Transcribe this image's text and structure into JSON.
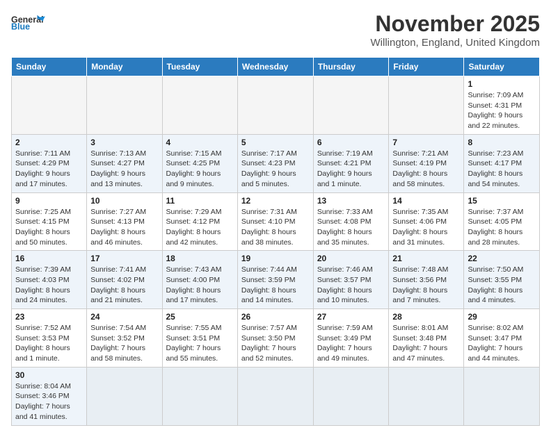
{
  "header": {
    "logo_general": "General",
    "logo_blue": "Blue",
    "month_title": "November 2025",
    "location": "Willington, England, United Kingdom"
  },
  "weekdays": [
    "Sunday",
    "Monday",
    "Tuesday",
    "Wednesday",
    "Thursday",
    "Friday",
    "Saturday"
  ],
  "weeks": [
    [
      {
        "day": "",
        "info": ""
      },
      {
        "day": "",
        "info": ""
      },
      {
        "day": "",
        "info": ""
      },
      {
        "day": "",
        "info": ""
      },
      {
        "day": "",
        "info": ""
      },
      {
        "day": "",
        "info": ""
      },
      {
        "day": "1",
        "info": "Sunrise: 7:09 AM\nSunset: 4:31 PM\nDaylight: 9 hours\nand 22 minutes."
      }
    ],
    [
      {
        "day": "2",
        "info": "Sunrise: 7:11 AM\nSunset: 4:29 PM\nDaylight: 9 hours\nand 17 minutes."
      },
      {
        "day": "3",
        "info": "Sunrise: 7:13 AM\nSunset: 4:27 PM\nDaylight: 9 hours\nand 13 minutes."
      },
      {
        "day": "4",
        "info": "Sunrise: 7:15 AM\nSunset: 4:25 PM\nDaylight: 9 hours\nand 9 minutes."
      },
      {
        "day": "5",
        "info": "Sunrise: 7:17 AM\nSunset: 4:23 PM\nDaylight: 9 hours\nand 5 minutes."
      },
      {
        "day": "6",
        "info": "Sunrise: 7:19 AM\nSunset: 4:21 PM\nDaylight: 9 hours\nand 1 minute."
      },
      {
        "day": "7",
        "info": "Sunrise: 7:21 AM\nSunset: 4:19 PM\nDaylight: 8 hours\nand 58 minutes."
      },
      {
        "day": "8",
        "info": "Sunrise: 7:23 AM\nSunset: 4:17 PM\nDaylight: 8 hours\nand 54 minutes."
      }
    ],
    [
      {
        "day": "9",
        "info": "Sunrise: 7:25 AM\nSunset: 4:15 PM\nDaylight: 8 hours\nand 50 minutes."
      },
      {
        "day": "10",
        "info": "Sunrise: 7:27 AM\nSunset: 4:13 PM\nDaylight: 8 hours\nand 46 minutes."
      },
      {
        "day": "11",
        "info": "Sunrise: 7:29 AM\nSunset: 4:12 PM\nDaylight: 8 hours\nand 42 minutes."
      },
      {
        "day": "12",
        "info": "Sunrise: 7:31 AM\nSunset: 4:10 PM\nDaylight: 8 hours\nand 38 minutes."
      },
      {
        "day": "13",
        "info": "Sunrise: 7:33 AM\nSunset: 4:08 PM\nDaylight: 8 hours\nand 35 minutes."
      },
      {
        "day": "14",
        "info": "Sunrise: 7:35 AM\nSunset: 4:06 PM\nDaylight: 8 hours\nand 31 minutes."
      },
      {
        "day": "15",
        "info": "Sunrise: 7:37 AM\nSunset: 4:05 PM\nDaylight: 8 hours\nand 28 minutes."
      }
    ],
    [
      {
        "day": "16",
        "info": "Sunrise: 7:39 AM\nSunset: 4:03 PM\nDaylight: 8 hours\nand 24 minutes."
      },
      {
        "day": "17",
        "info": "Sunrise: 7:41 AM\nSunset: 4:02 PM\nDaylight: 8 hours\nand 21 minutes."
      },
      {
        "day": "18",
        "info": "Sunrise: 7:43 AM\nSunset: 4:00 PM\nDaylight: 8 hours\nand 17 minutes."
      },
      {
        "day": "19",
        "info": "Sunrise: 7:44 AM\nSunset: 3:59 PM\nDaylight: 8 hours\nand 14 minutes."
      },
      {
        "day": "20",
        "info": "Sunrise: 7:46 AM\nSunset: 3:57 PM\nDaylight: 8 hours\nand 10 minutes."
      },
      {
        "day": "21",
        "info": "Sunrise: 7:48 AM\nSunset: 3:56 PM\nDaylight: 8 hours\nand 7 minutes."
      },
      {
        "day": "22",
        "info": "Sunrise: 7:50 AM\nSunset: 3:55 PM\nDaylight: 8 hours\nand 4 minutes."
      }
    ],
    [
      {
        "day": "23",
        "info": "Sunrise: 7:52 AM\nSunset: 3:53 PM\nDaylight: 8 hours\nand 1 minute."
      },
      {
        "day": "24",
        "info": "Sunrise: 7:54 AM\nSunset: 3:52 PM\nDaylight: 7 hours\nand 58 minutes."
      },
      {
        "day": "25",
        "info": "Sunrise: 7:55 AM\nSunset: 3:51 PM\nDaylight: 7 hours\nand 55 minutes."
      },
      {
        "day": "26",
        "info": "Sunrise: 7:57 AM\nSunset: 3:50 PM\nDaylight: 7 hours\nand 52 minutes."
      },
      {
        "day": "27",
        "info": "Sunrise: 7:59 AM\nSunset: 3:49 PM\nDaylight: 7 hours\nand 49 minutes."
      },
      {
        "day": "28",
        "info": "Sunrise: 8:01 AM\nSunset: 3:48 PM\nDaylight: 7 hours\nand 47 minutes."
      },
      {
        "day": "29",
        "info": "Sunrise: 8:02 AM\nSunset: 3:47 PM\nDaylight: 7 hours\nand 44 minutes."
      }
    ],
    [
      {
        "day": "30",
        "info": "Sunrise: 8:04 AM\nSunset: 3:46 PM\nDaylight: 7 hours\nand 41 minutes."
      },
      {
        "day": "",
        "info": ""
      },
      {
        "day": "",
        "info": ""
      },
      {
        "day": "",
        "info": ""
      },
      {
        "day": "",
        "info": ""
      },
      {
        "day": "",
        "info": ""
      },
      {
        "day": "",
        "info": ""
      }
    ]
  ]
}
